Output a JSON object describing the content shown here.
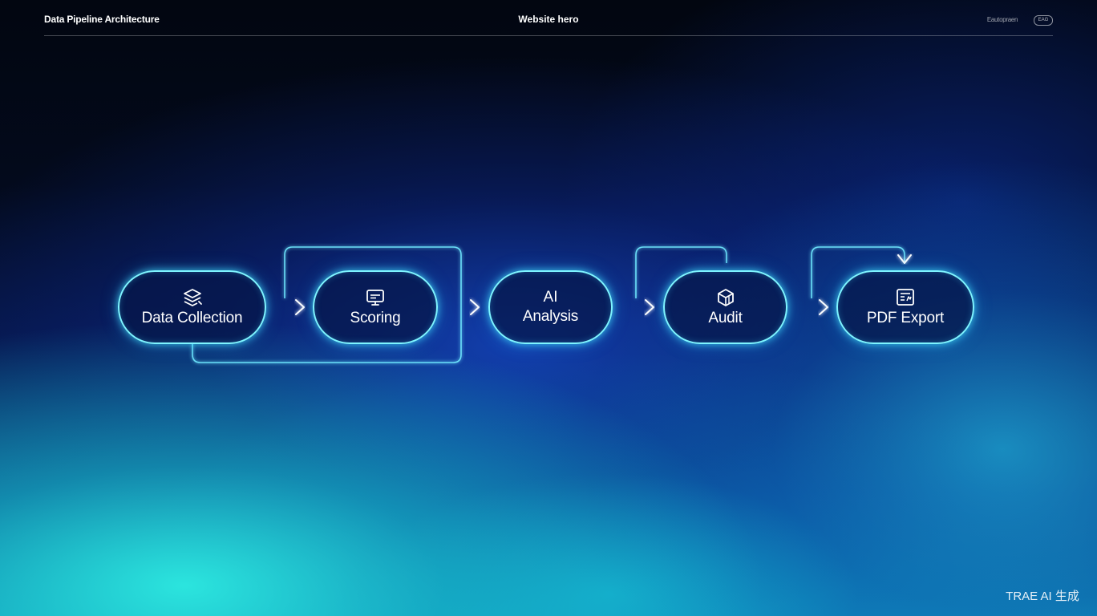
{
  "header": {
    "left_title": "Data Pipeline Architecture",
    "center_title": "Website hero",
    "right_text": "Eautopraen",
    "right_badge": "EAG"
  },
  "nodes": [
    {
      "id": "data-collection",
      "label": "Data Collection",
      "icon": "stack-icon"
    },
    {
      "id": "scoring",
      "label": "Scoring",
      "icon": "monitor-icon"
    },
    {
      "id": "ai-analysis",
      "label_top": "AI",
      "label": "Analysis",
      "icon": ""
    },
    {
      "id": "audit",
      "label": "Audit",
      "icon": "cube-icon"
    },
    {
      "id": "pdf-export",
      "label": "PDF Export",
      "icon": "document-icon"
    }
  ],
  "edges": [
    {
      "from": "data-collection",
      "to": "scoring"
    },
    {
      "from": "scoring",
      "to": "ai-analysis"
    },
    {
      "from": "ai-analysis",
      "to": "audit"
    },
    {
      "from": "audit",
      "to": "pdf-export"
    }
  ],
  "colors": {
    "node_stroke": "#7ef4ff",
    "connector": "#6fe9ff",
    "arrow": "#ffffff"
  },
  "watermark": "TRAE AI 生成"
}
